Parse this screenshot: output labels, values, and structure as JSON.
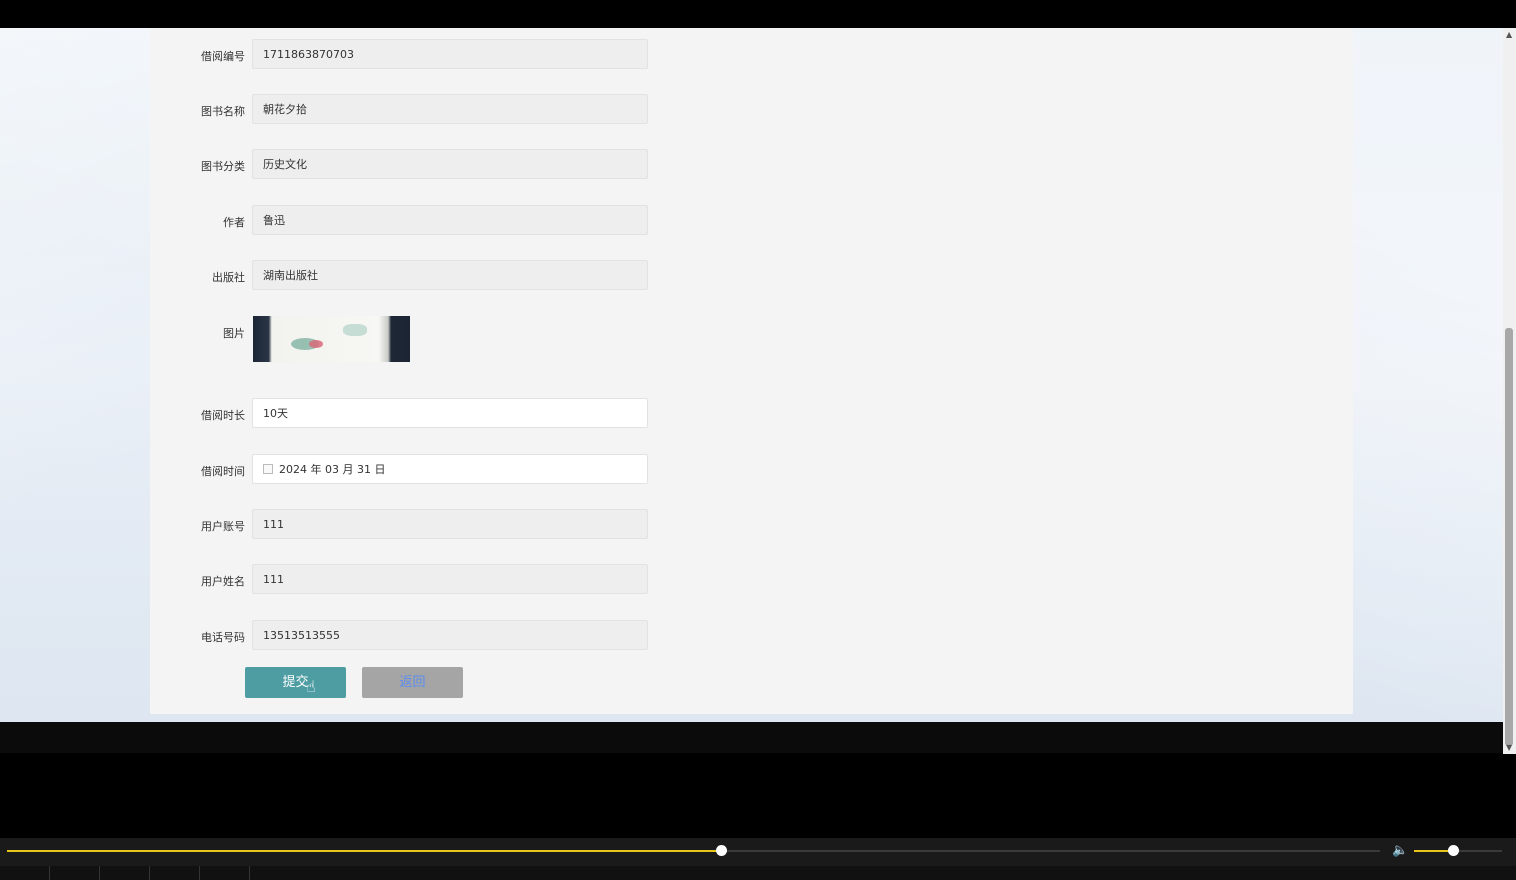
{
  "form": {
    "fields": [
      {
        "label": "借阅编号",
        "value": "1711863870703"
      },
      {
        "label": "图书名称",
        "value": "朝花夕拾"
      },
      {
        "label": "图书分类",
        "value": "历史文化"
      },
      {
        "label": "作者",
        "value": "鲁迅"
      },
      {
        "label": "出版社",
        "value": "湖南出版社"
      }
    ],
    "image_label": "图片",
    "duration": {
      "label": "借阅时长",
      "value": "10天"
    },
    "borrow_time": {
      "label": "借阅时间",
      "value": "2024 年 03 月 31 日"
    },
    "fields2": [
      {
        "label": "用户账号",
        "value": "111"
      },
      {
        "label": "用户姓名",
        "value": "111"
      },
      {
        "label": "电话号码",
        "value": "13513513555"
      }
    ],
    "submit_label": "提交",
    "back_label": "返回"
  },
  "player": {
    "progress_fraction": 0.52,
    "volume_fraction": 0.44
  },
  "colors": {
    "submit": "#4e9da3",
    "back": "#a5a5a5",
    "progress": "#e6c419"
  }
}
